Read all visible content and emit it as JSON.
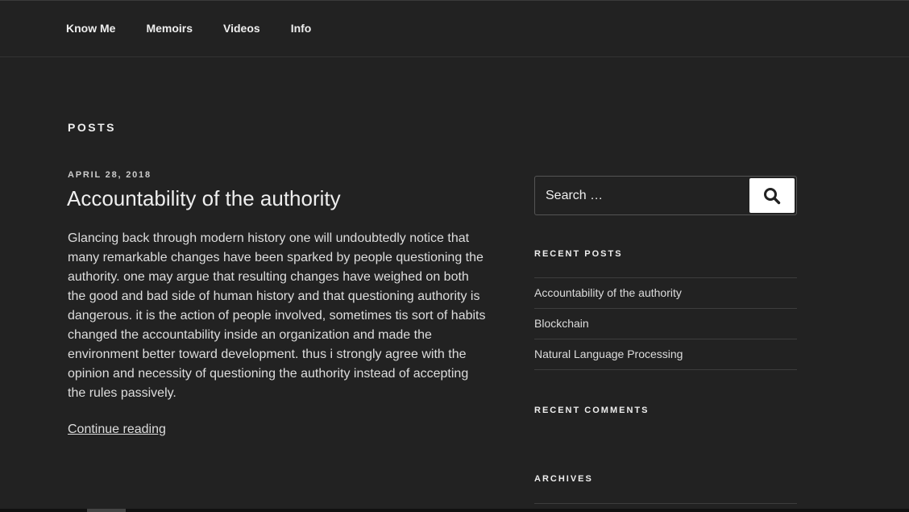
{
  "nav": {
    "items": [
      "Know Me",
      "Memoirs",
      "Videos",
      "Info"
    ]
  },
  "page": {
    "header": "POSTS"
  },
  "post": {
    "date": "APRIL 28, 2018",
    "title": "Accountability of the authority",
    "excerpt": "Glancing back through modern history one will undoubtedly notice that many remarkable changes have been sparked by people questioning the authority. one may argue that resulting changes have weighed on both the good and bad side of human history and that questioning authority is dangerous. it is the action of people involved, sometimes tis sort of habits changed the accountability inside an organization and made the environment better toward development. thus i strongly agree with the opinion and necessity of questioning the authority instead of accepting the rules passively.",
    "continue_label": "Continue reading"
  },
  "sidebar": {
    "search": {
      "placeholder": "Search …",
      "button_icon": "search-icon"
    },
    "recent_posts": {
      "title": "RECENT POSTS",
      "items": [
        "Accountability of the authority",
        "Blockchain",
        "Natural Language Processing"
      ]
    },
    "recent_comments": {
      "title": "RECENT COMMENTS"
    },
    "archives": {
      "title": "ARCHIVES"
    }
  },
  "colors": {
    "background": "#222222",
    "text": "#dddddd",
    "search_button": "#ffffff"
  }
}
